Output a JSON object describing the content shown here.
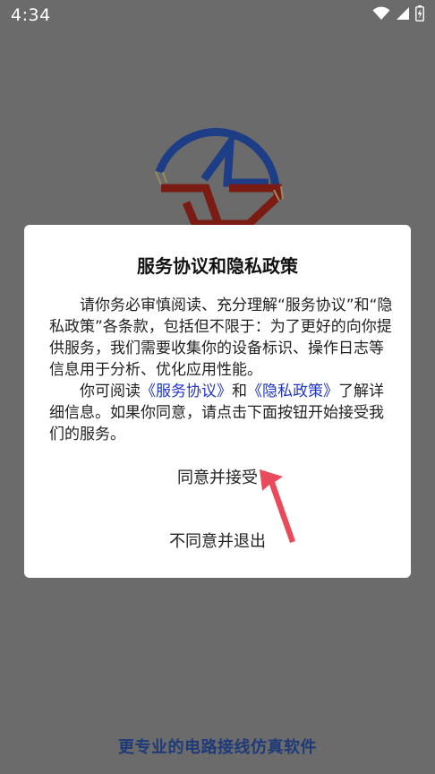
{
  "status_bar": {
    "time": "4:34",
    "icons": [
      "wifi-icon",
      "cellular-signal-icon",
      "battery-charging-icon"
    ]
  },
  "dialog": {
    "title": "服务协议和隐私政策",
    "paragraph1": "请你务必审慎阅读、充分理解“服务协议”和“隐私政策”各条款，包括但不限于：为了更好的向你提供服务，我们需要收集你的设备标识、操作日志等信息用于分析、优化应用性能。",
    "paragraph2_prefix": "你可阅读",
    "service_link": "《服务协议》",
    "paragraph2_and": "和",
    "privacy_link": "《隐私政策》",
    "paragraph2_suffix": "了解详细信息。如果你同意，请点击下面按钮开始接受我们的服务。",
    "accept_label": "同意并接受",
    "decline_label": "不同意并退出"
  },
  "footer": {
    "tagline": "更专业的电路接线仿真软件"
  },
  "colors": {
    "overlay_background": "#6b6b6b",
    "link": "#2035c9",
    "tagline": "#1f3a78",
    "logo_blue": "#1d3d86",
    "logo_red": "#7a1c14",
    "arrow": "#e94b5a"
  }
}
